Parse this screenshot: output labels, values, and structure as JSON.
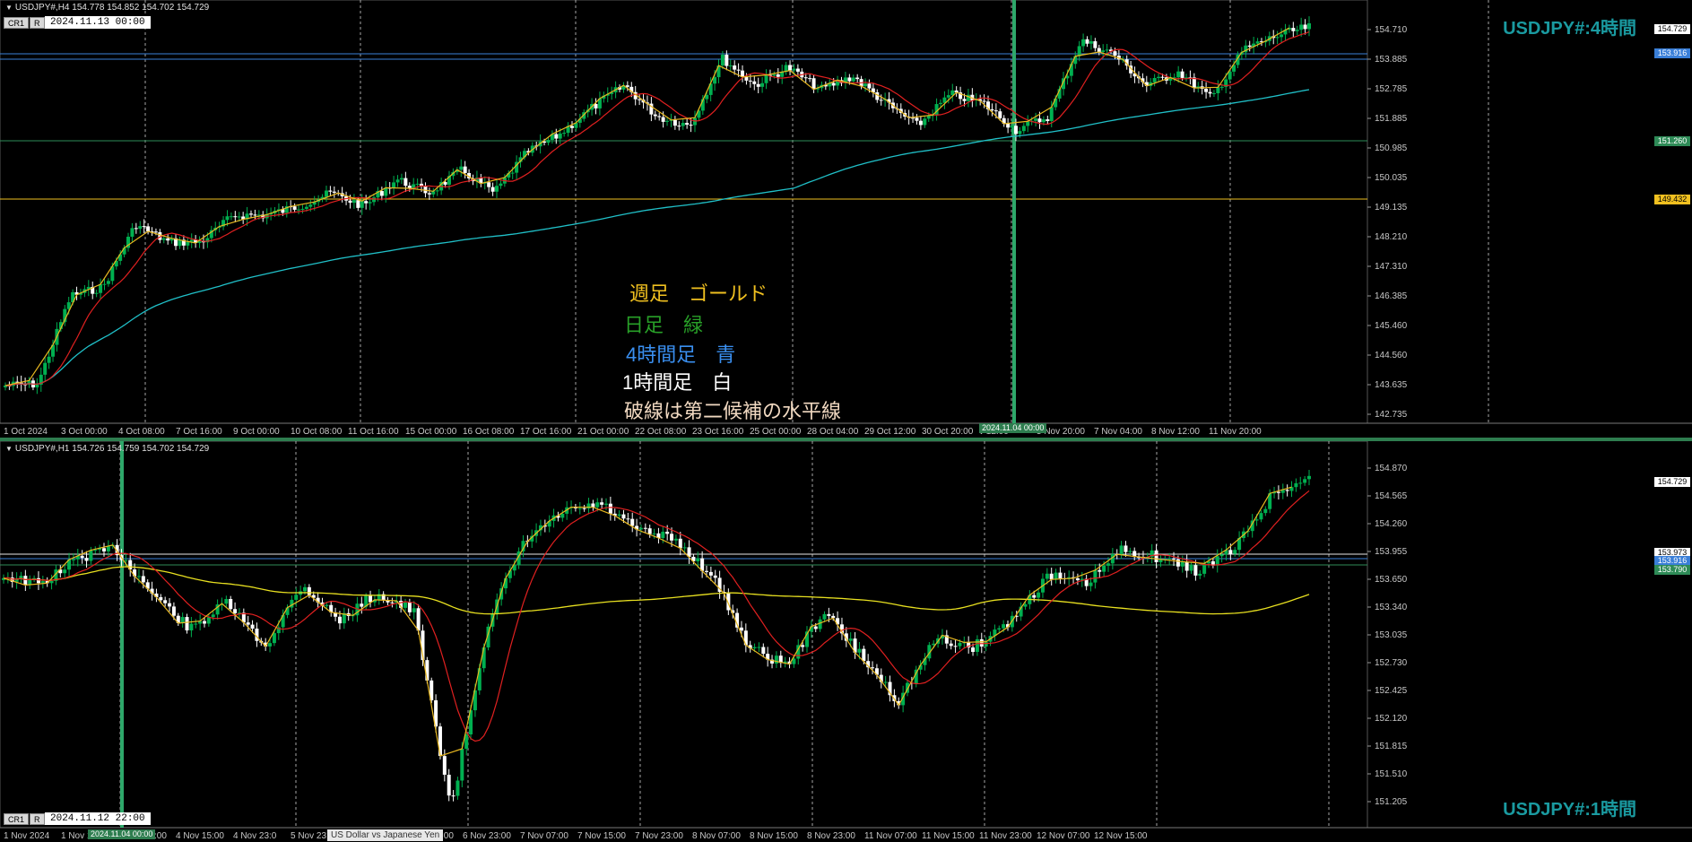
{
  "top": {
    "info_text": "USDJPY#,H4  154.778 154.852 154.702 154.729",
    "cr_labels": [
      "CR1",
      "R"
    ],
    "datetime": "2024.11.13 00:00",
    "title": "USDJPY#:4時間",
    "legend": [
      {
        "text": "週足　ゴールド",
        "color": "#f0c020"
      },
      {
        "text": "日足　緑",
        "color": "#28a028"
      },
      {
        "text": "4時間足　青",
        "color": "#3a8ff0"
      },
      {
        "text": "1時間足　白",
        "color": "#ffffff"
      },
      {
        "text": "破線は第二候補の水平線",
        "color": "#f0d8c0"
      }
    ],
    "price_ticks": [
      "154.710",
      "153.885",
      "152.785",
      "151.885",
      "150.985",
      "150.035",
      "149.135",
      "148.210",
      "147.310",
      "146.385",
      "145.460",
      "144.560",
      "143.635",
      "142.735"
    ],
    "price_tags": [
      {
        "label": "154.729",
        "bg": "#ffffff",
        "fg": "#000000"
      },
      {
        "label": "153.916",
        "bg": "#3a7fd8",
        "fg": "#ffffff"
      },
      {
        "label": "151.260",
        "bg": "#2e8b57",
        "fg": "#ffffff"
      },
      {
        "label": "149.432",
        "bg": "#f0c020",
        "fg": "#000000"
      }
    ],
    "date_ticks": [
      "1 Oct 2024",
      "3 Oct 00:00",
      "4 Oct 08:00",
      "7 Oct 16:00",
      "9 Oct 00:00",
      "10 Oct 08:00",
      "11 Oct 16:00",
      "15 Oct 00:00",
      "16 Oct 08:00",
      "17 Oct 16:00",
      "21 Oct 00:00",
      "22 Oct 08:00",
      "23 Oct 16:00",
      "25 Oct 00:00",
      "28 Oct 04:00",
      "29 Oct 12:00",
      "30 Oct 20:00",
      "v 12:00",
      "5 Nov 20:00",
      "7 Nov 04:00",
      "8 Nov 12:00",
      "11 Nov 20:00"
    ],
    "cursor_date": "2024.11.04 00:00"
  },
  "bottom": {
    "info_text": "USDJPY#,H1  154.726 154.759 154.702 154.729",
    "cr_labels": [
      "CR1",
      "R"
    ],
    "datetime": "2024.11.12 22:00",
    "title": "USDJPY#:1時間",
    "price_ticks": [
      "154.870",
      "154.565",
      "154.260",
      "153.955",
      "153.650",
      "153.340",
      "153.035",
      "152.730",
      "152.425",
      "152.120",
      "151.815",
      "151.510",
      "151.205"
    ],
    "price_tags": [
      {
        "label": "154.729",
        "bg": "#ffffff",
        "fg": "#000000"
      },
      {
        "label": "153.973",
        "bg": "#ffffff",
        "fg": "#000000"
      },
      {
        "label": "153.916",
        "bg": "#3a7fd8",
        "fg": "#ffffff"
      },
      {
        "label": "153.790",
        "bg": "#2e8b57",
        "fg": "#ffffff"
      }
    ],
    "date_ticks": [
      "1 Nov 2024",
      "1 Nov 1",
      "4 Nov 07:00",
      "4 Nov 15:00",
      "4 Nov 23:0",
      "5 Nov 23:00",
      "6 Nov 07:00",
      "6 Nov 15:00",
      "6 Nov 23:00",
      "7 Nov 07:00",
      "7 Nov 15:00",
      "7 Nov 23:00",
      "8 Nov 07:00",
      "8 Nov 15:00",
      "8 Nov 23:00",
      "11 Nov 07:00",
      "11 Nov 15:00",
      "11 Nov 23:00",
      "12 Nov 07:00",
      "12 Nov 15:00"
    ],
    "cursor_date": "2024.11.04 00:00",
    "tooltip": "US Dollar vs Japanese Yen"
  },
  "colors": {
    "bull": "#00b050",
    "bear": "#ffffff",
    "ma_fast": "#e02020",
    "ma_slow_top": "#20c0c8",
    "ma_slow_bot": "#e8e020",
    "zigzag": "#e8b820",
    "grid": "#cfcfcf"
  }
}
